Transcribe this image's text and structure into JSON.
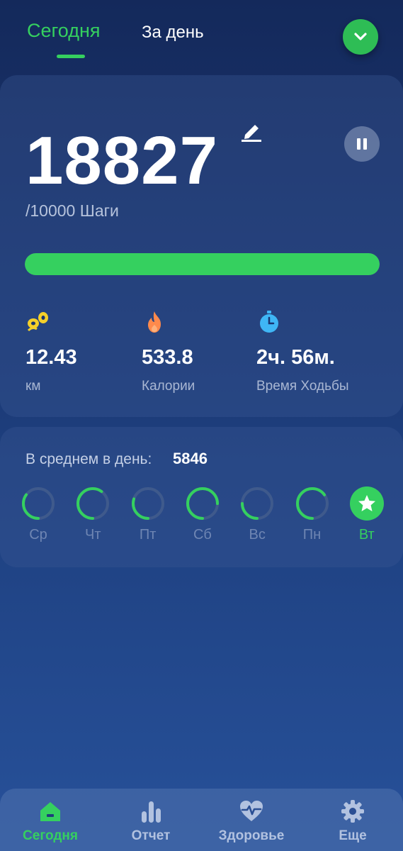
{
  "tabs": {
    "today": "Сегодня",
    "day": "За день"
  },
  "steps": {
    "value": "18827",
    "goal_text": "/10000 Шаги",
    "progress_fraction": 1.0
  },
  "stats": [
    {
      "icon": "footprints-icon",
      "value": "12.43",
      "label": "км",
      "color": "#f5d02a"
    },
    {
      "icon": "flame-icon",
      "value": "533.8",
      "label": "Калории",
      "color": "#ff8a4c"
    },
    {
      "icon": "stopwatch-icon",
      "value": "2ч. 56м.",
      "label": "Время Ходьбы",
      "color": "#3fb6f5"
    }
  ],
  "average": {
    "label": "В среднем в день:",
    "value": "5846"
  },
  "week": [
    {
      "label": "Ср",
      "fraction": 0.35,
      "completed": false
    },
    {
      "label": "Чт",
      "fraction": 0.6,
      "completed": false
    },
    {
      "label": "Пт",
      "fraction": 0.3,
      "completed": false
    },
    {
      "label": "Сб",
      "fraction": 0.75,
      "completed": false
    },
    {
      "label": "Вс",
      "fraction": 0.25,
      "completed": false
    },
    {
      "label": "Пн",
      "fraction": 0.65,
      "completed": false
    },
    {
      "label": "Вт",
      "fraction": 1.0,
      "completed": true
    }
  ],
  "nav": [
    {
      "label": "Сегодня",
      "icon": "home-icon",
      "active": true
    },
    {
      "label": "Отчет",
      "icon": "bar-chart-icon",
      "active": false
    },
    {
      "label": "Здоровье",
      "icon": "heart-pulse-icon",
      "active": false
    },
    {
      "label": "Еще",
      "icon": "gear-icon",
      "active": false
    }
  ],
  "colors": {
    "accent": "#35d05f",
    "ring_track": "#3f5a8c"
  }
}
